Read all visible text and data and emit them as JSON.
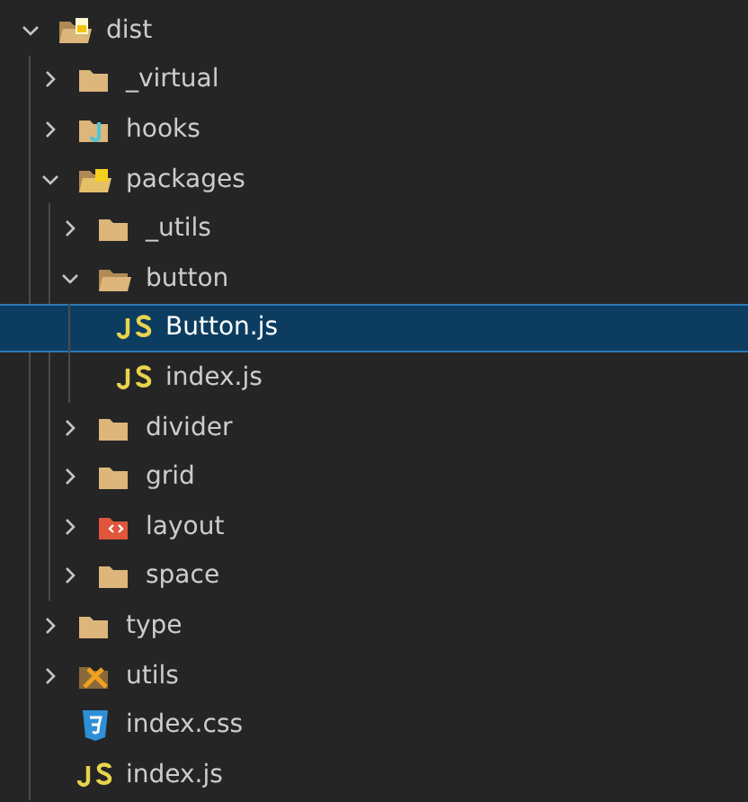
{
  "explorer": {
    "tree": [
      {
        "name": "dist",
        "kind": "dist",
        "expanded": true,
        "selected": false,
        "children": [
          {
            "name": "_virtual",
            "kind": "folder",
            "expanded": false,
            "selected": false
          },
          {
            "name": "hooks",
            "kind": "hooks",
            "expanded": false,
            "selected": false
          },
          {
            "name": "packages",
            "kind": "packages",
            "expanded": true,
            "selected": false,
            "children": [
              {
                "name": "_utils",
                "kind": "folder",
                "expanded": false,
                "selected": false
              },
              {
                "name": "button",
                "kind": "folder",
                "expanded": true,
                "selected": false,
                "children": [
                  {
                    "name": "Button.js",
                    "kind": "js",
                    "selected": true
                  },
                  {
                    "name": "index.js",
                    "kind": "js",
                    "selected": false
                  }
                ]
              },
              {
                "name": "divider",
                "kind": "folder",
                "expanded": false,
                "selected": false
              },
              {
                "name": "grid",
                "kind": "folder",
                "expanded": false,
                "selected": false
              },
              {
                "name": "layout",
                "kind": "layout",
                "expanded": false,
                "selected": false
              },
              {
                "name": "space",
                "kind": "folder",
                "expanded": false,
                "selected": false
              }
            ]
          },
          {
            "name": "type",
            "kind": "folder",
            "expanded": false,
            "selected": false
          },
          {
            "name": "utils",
            "kind": "tools",
            "expanded": false,
            "selected": false
          },
          {
            "name": "index.css",
            "kind": "css",
            "selected": false
          },
          {
            "name": "index.js",
            "kind": "js",
            "selected": false
          }
        ]
      }
    ]
  }
}
